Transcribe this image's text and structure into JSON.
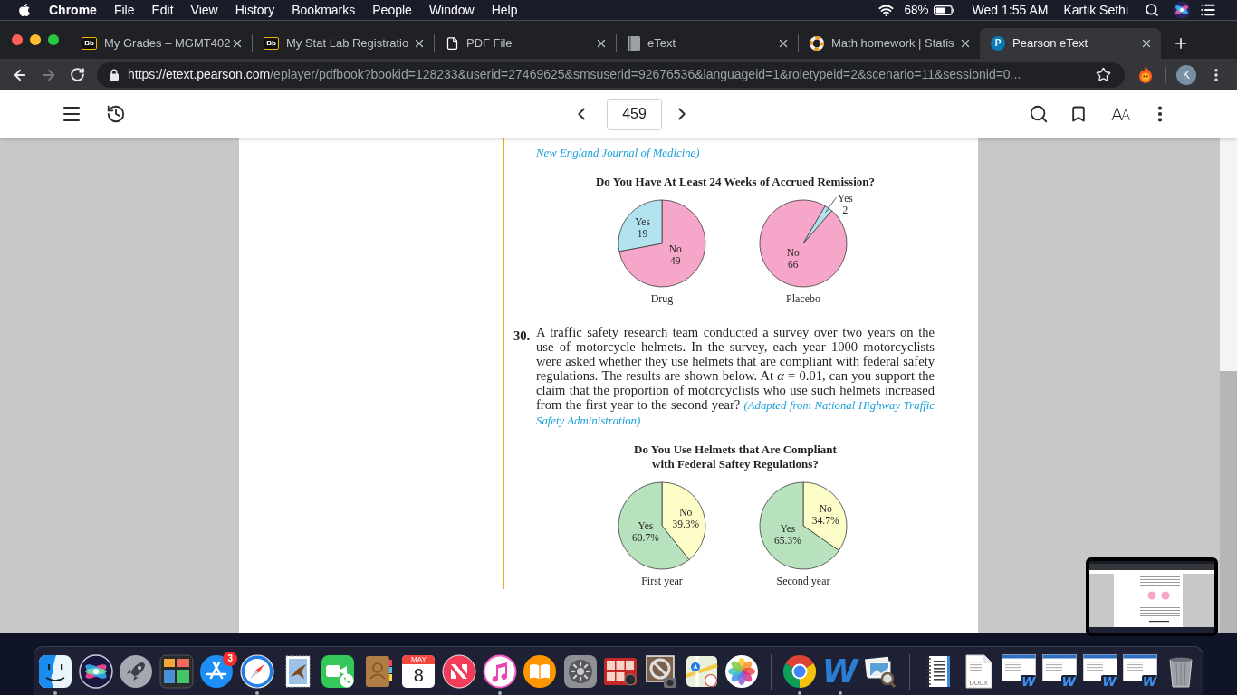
{
  "menu_bar": {
    "app_name": "Chrome",
    "menus": [
      "File",
      "Edit",
      "View",
      "History",
      "Bookmarks",
      "People",
      "Window",
      "Help"
    ],
    "battery_percent": "68%",
    "clock": "Wed 1:55 AM",
    "user": "Kartik Sethi"
  },
  "browser": {
    "tabs": [
      {
        "kind": "blackboard",
        "favicon_text": "Bb",
        "title": "My Grades – MGMT402",
        "selected": false
      },
      {
        "kind": "blackboard",
        "favicon_text": "Bb",
        "title": "My Stat Lab Registratio",
        "selected": false
      },
      {
        "kind": "document",
        "title": "PDF File",
        "selected": false
      },
      {
        "kind": "book",
        "title": "eText",
        "selected": false
      },
      {
        "kind": "lifebuoy",
        "title": "Math homework | Statis",
        "selected": false
      },
      {
        "kind": "pearson",
        "favicon_text": "P",
        "title": "Pearson eText",
        "selected": true
      }
    ],
    "toolbar": {
      "back": {
        "disabled": false
      },
      "forward": {
        "disabled": true
      },
      "url": {
        "scheme": "https://",
        "host": "etext.pearson.com",
        "path": "/eplayer/pdfbook?bookid=128233&userid=27469625&smsuserid=92676536&languageid=1&roletypeid=2&scenario=11&sessionid=0..."
      },
      "profile_initial": "K"
    }
  },
  "reader_toolbar": {
    "page_number": "459",
    "text_size_label": "AA"
  },
  "page": {
    "blocks": [
      {
        "kind": "source",
        "text": "New England Journal of Medicine)"
      },
      {
        "kind": "figure",
        "title": "Do You Have At Least 24 Weeks of Accrued Remission?",
        "charts": [
          {
            "caption": "Drug",
            "chart_data": {
              "type": "pie",
              "categories": [
                "No",
                "Yes"
              ],
              "values": [
                49,
                19
              ],
              "colors": [
                "#f5a6c9",
                "#b3e2ef"
              ],
              "data_labels": true
            }
          },
          {
            "caption": "Placebo",
            "chart_data": {
              "type": "pie",
              "categories": [
                "No",
                "Yes"
              ],
              "values": [
                66,
                2
              ],
              "colors": [
                "#f5a6c9",
                "#b3e2ef"
              ],
              "data_labels": true
            }
          }
        ]
      },
      {
        "kind": "exercise",
        "number": "30.",
        "text": "A traffic safety research team conducted a survey over two years on the use of motorcycle helmets. In the survey, each year 1000 motorcyclists were asked whether they use helmets that are compliant with federal safety regulations. The results are shown below. At *α* = 0.01, can you support the claim that the proportion of motorcyclists who use such helmets increased from the first year to the second year?",
        "source": "(Adapted from National Highway Traffic Safety Administration)"
      },
      {
        "kind": "figure",
        "title": "Do You Use Helmets that Are Compliant with Federal Saftey Regulations?",
        "charts": [
          {
            "caption": "First year",
            "chart_data": {
              "type": "pie",
              "categories": [
                "No",
                "Yes"
              ],
              "values": [
                39.3,
                60.7
              ],
              "colors": [
                "#fdfdc8",
                "#b7e2bd"
              ],
              "value_labels": [
                "39.3%",
                "60.7%"
              ]
            }
          },
          {
            "caption": "Second year",
            "chart_data": {
              "type": "pie",
              "categories": [
                "No",
                "Yes"
              ],
              "values": [
                34.7,
                65.3
              ],
              "colors": [
                "#fdfdc8",
                "#b7e2bd"
              ],
              "value_labels": [
                "34.7%",
                "65.3%"
              ]
            }
          }
        ]
      }
    ]
  },
  "dock": {
    "sections": [
      {
        "items": [
          {
            "kind": "finder",
            "running": true
          },
          {
            "kind": "siri",
            "running": false
          },
          {
            "kind": "launchpad",
            "running": false
          },
          {
            "kind": "mission_control",
            "running": false
          },
          {
            "kind": "app_store",
            "running": false,
            "badge": "3"
          },
          {
            "kind": "safari",
            "running": true
          },
          {
            "kind": "mail",
            "running": false
          },
          {
            "kind": "facetime",
            "running": false
          },
          {
            "kind": "contacts",
            "running": false
          },
          {
            "kind": "calendar",
            "running": false,
            "month": "MAY",
            "day": "8"
          },
          {
            "kind": "news",
            "running": false
          },
          {
            "kind": "music",
            "running": true
          },
          {
            "kind": "books",
            "running": false
          },
          {
            "kind": "system_preferences",
            "running": false
          },
          {
            "kind": "photo_booth",
            "running": false
          },
          {
            "kind": "image_capture",
            "running": false
          },
          {
            "kind": "maps",
            "running": false
          },
          {
            "kind": "photos",
            "running": false
          }
        ]
      },
      {
        "items": [
          {
            "kind": "chrome",
            "running": true
          },
          {
            "kind": "word",
            "running": true,
            "label": "W"
          },
          {
            "kind": "preview",
            "running": false
          }
        ]
      },
      {
        "items": [
          {
            "kind": "notebook",
            "running": false
          },
          {
            "kind": "docx_file",
            "running": false,
            "label": "DOCX"
          },
          {
            "kind": "word_document",
            "running": false,
            "label": "W"
          },
          {
            "kind": "word_document",
            "running": false,
            "label": "W"
          },
          {
            "kind": "word_document",
            "running": false,
            "label": "W"
          },
          {
            "kind": "word_document",
            "running": false,
            "label": "W"
          },
          {
            "kind": "trash",
            "running": false
          }
        ]
      }
    ]
  }
}
